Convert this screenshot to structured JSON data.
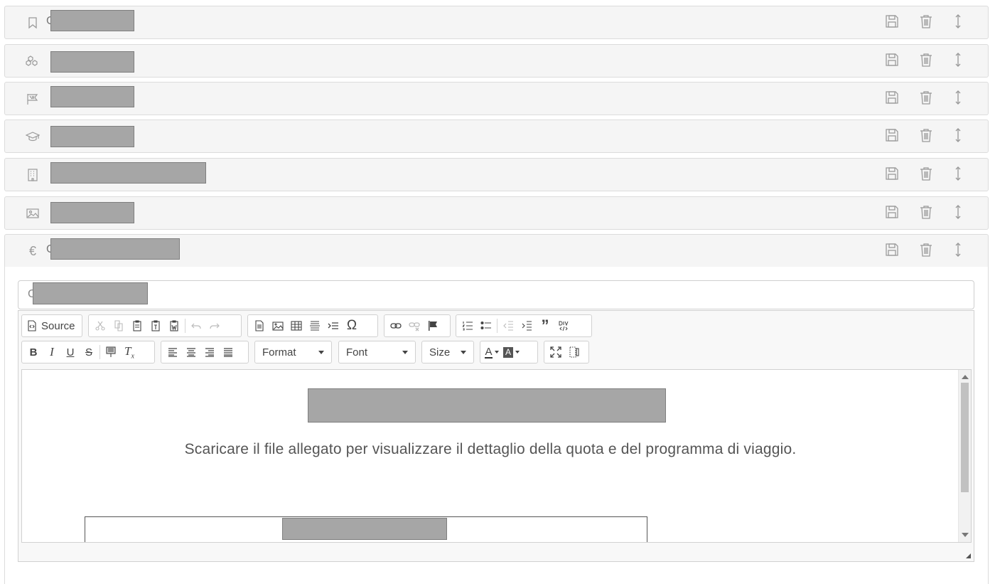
{
  "panels": [
    {
      "icon": "bookmark-icon",
      "prefix": "C"
    },
    {
      "icon": "cubes-icon",
      "prefix": ""
    },
    {
      "icon": "flag-icon",
      "prefix": ""
    },
    {
      "icon": "graduation-cap-icon",
      "prefix": ""
    },
    {
      "icon": "building-icon",
      "prefix": ""
    },
    {
      "icon": "image-icon",
      "prefix": ""
    },
    {
      "icon": "euro-icon",
      "prefix": "C"
    }
  ],
  "panel_actions": {
    "save": "save-icon",
    "delete": "trash-icon",
    "move": "vertical-arrows-icon"
  },
  "open_panel": {
    "title_prefix": "C",
    "toolbar": {
      "source_label": "Source",
      "bold": "B",
      "italic": "I",
      "underline": "U",
      "strike": "S",
      "format_label": "Format",
      "font_label": "Font",
      "size_label": "Size",
      "text_color": "A",
      "bg_color": "A"
    },
    "content_text": "Scaricare il file allegato per visualizzare il dettaglio della quota e del programma di viaggio."
  },
  "colors": {
    "panel_bg": "#f5f5f5",
    "icon": "#9a9a9a",
    "redaction": "#a6a6a6"
  }
}
